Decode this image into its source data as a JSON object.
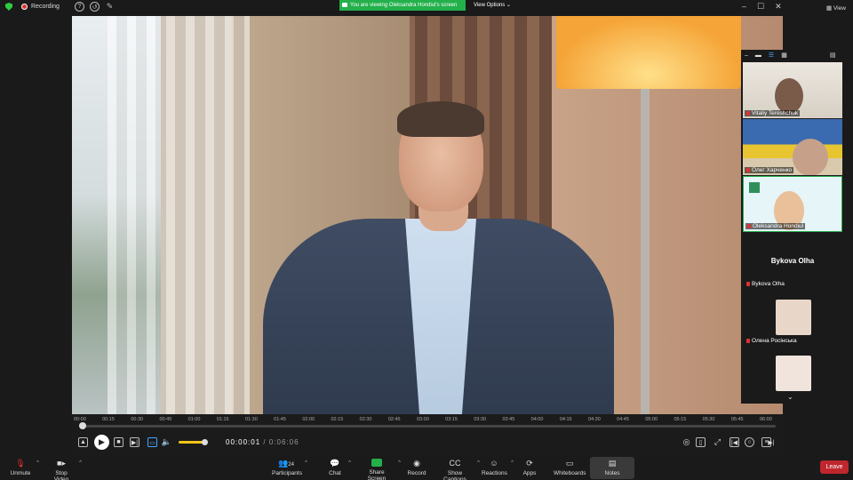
{
  "recording": {
    "label": "Recording"
  },
  "banner": {
    "text": "You are viewing Oleksandra Hondiul's screen",
    "view_options": "View Options"
  },
  "top_right": {
    "view_label": "View"
  },
  "player": {
    "ticks": [
      "00:00",
      "00:15",
      "00:30",
      "00:45",
      "01:00",
      "01:15",
      "01:30",
      "01:45",
      "02:00",
      "02:15",
      "02:30",
      "02:45",
      "03:00",
      "03:15",
      "03:30",
      "03:45",
      "04:00",
      "04:15",
      "04:30",
      "04:45",
      "05:00",
      "05:15",
      "05:30",
      "05:45",
      "06:00"
    ],
    "current_time": "00:00:01",
    "total_time": "/ 0:06:06",
    "progress": 0.003,
    "volume": 0.85
  },
  "gallery": {
    "tiles": [
      {
        "name": "Vitaliy Tereshchuk"
      },
      {
        "name": "Олег Харченко"
      },
      {
        "name": "Oleksandra Hondiul"
      },
      {
        "name": "Bykova Olha",
        "big_name": "Bykova Olha"
      },
      {
        "name": "Олена Росінська"
      }
    ]
  },
  "toolbar": {
    "unmute": "Unmute",
    "stop_video": "Stop Video",
    "participants": "Participants",
    "participants_count": "24",
    "chat": "Chat",
    "share_screen": "Share Screen",
    "record": "Record",
    "show_captions": "Show Captions",
    "reactions": "Reactions",
    "apps": "Apps",
    "whiteboards": "Whiteboards",
    "notes": "Notes",
    "leave": "Leave"
  },
  "colors": {
    "accent_green": "#23b04b",
    "leave_red": "#c0262d",
    "volume_yellow": "#f5c518"
  }
}
